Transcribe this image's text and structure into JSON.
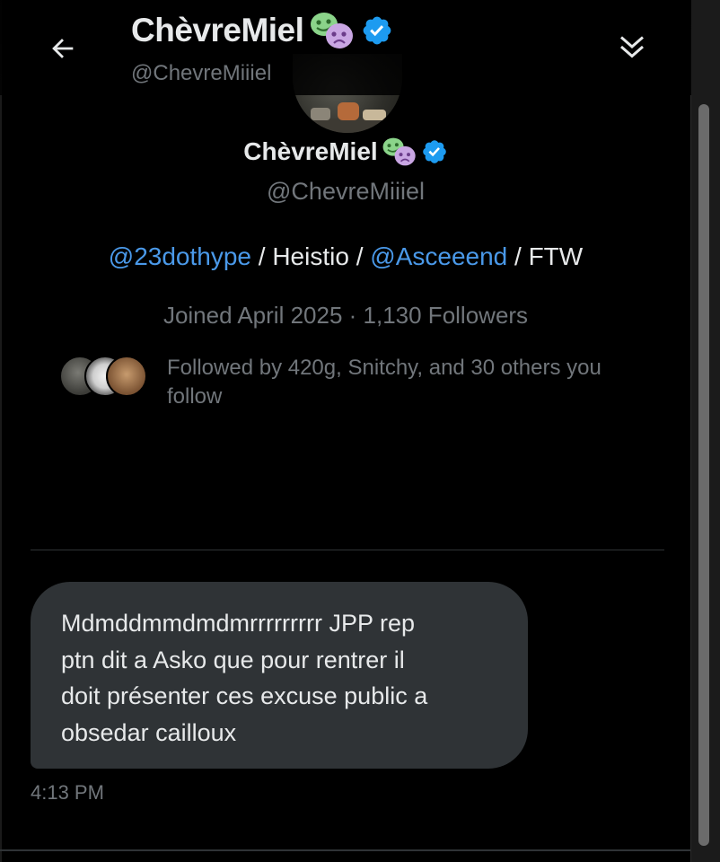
{
  "header": {
    "back_icon": "arrow-left-icon",
    "display_name": "ChèvreMiel",
    "handle": "@ChevreMiiiel",
    "collapse_icon": "double-chevron-down-icon"
  },
  "profile": {
    "display_name": "ChèvreMiel",
    "handle": "@ChevreMiiiel",
    "badge_icon": "verified-badge-icon",
    "emoji_icon": "theater-masks-icon",
    "bio": {
      "mention_1": "@23dothype",
      "sep_1": " / Heistio / ",
      "mention_2": "@Asceeend",
      "sep_2": " / FTW"
    },
    "meta": "Joined April 2025 · 1,130 Followers",
    "followed_by": "Followed by 420g, Snitchy, and 30 others you follow"
  },
  "message": {
    "text": "Mdmddmmdmdmrrrrrrrrr JPP rep\nptn dit a Asko que pour rentrer il\ndoit présenter ces excuse public a\nobsedar cailloux",
    "timestamp": "4:13 PM"
  },
  "colors": {
    "background": "#000000",
    "bubble": "#2f3336",
    "link": "#4a99e9",
    "muted": "#71767b",
    "verified": "#1d9bf0"
  }
}
